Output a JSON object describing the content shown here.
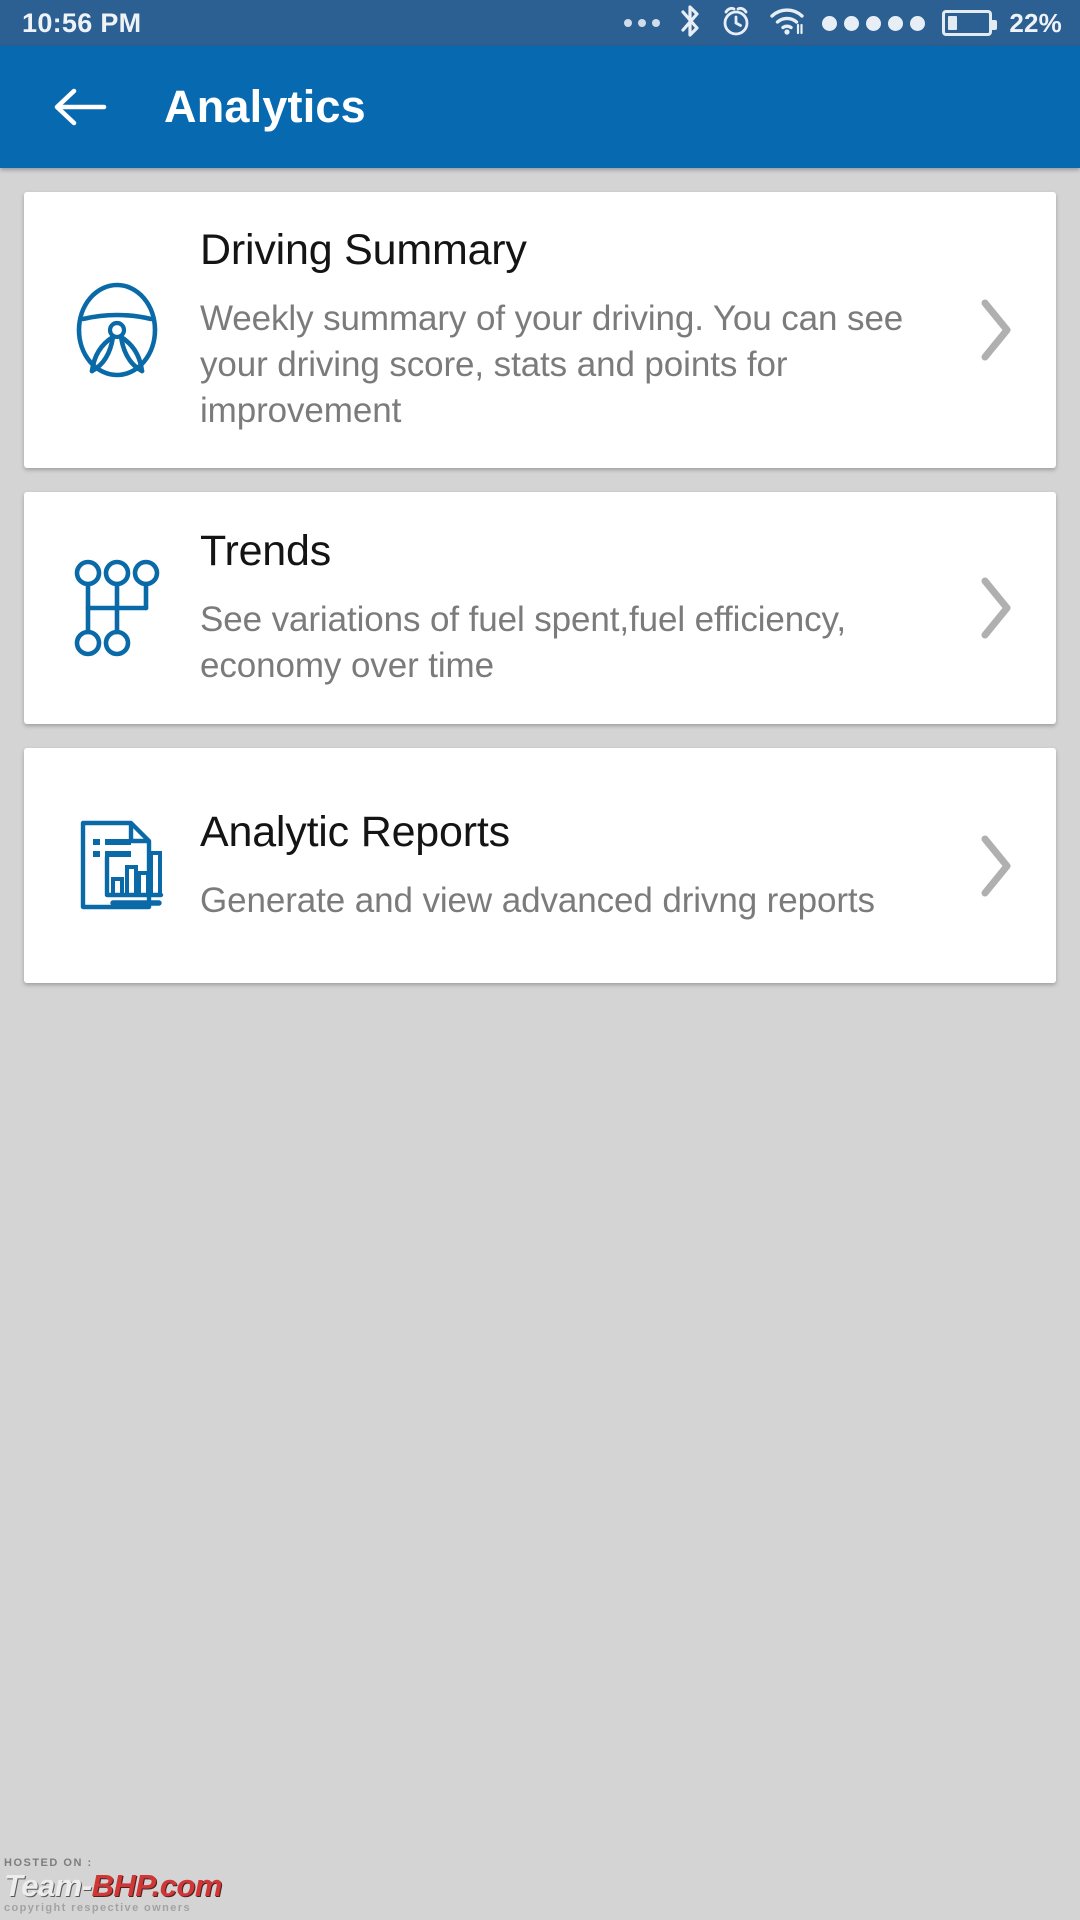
{
  "status_bar": {
    "time": "10:56 PM",
    "battery_percent": "22%",
    "battery_level": 22,
    "icons": [
      "more-dots-icon",
      "bluetooth-icon",
      "alarm-clock-icon",
      "wifi-icon"
    ],
    "signal_dot_count": 5,
    "background_color": "#2c5f92"
  },
  "app_bar": {
    "title": "Analytics",
    "back_icon": "arrow-left-icon",
    "background_color": "#0769b0",
    "text_color": "#ffffff"
  },
  "theme": {
    "page_background": "#d4d4d4",
    "card_background": "#ffffff",
    "accent": "#0a6aa8",
    "title_color": "#141414",
    "description_color": "#7b7b7b",
    "chevron_color": "#b0b0b0"
  },
  "cards": [
    {
      "id": "driving-summary",
      "icon": "steering-wheel-icon",
      "title": "Driving Summary",
      "description": "Weekly summary of your driving. You can see your driving score, stats and points for improvement",
      "chevron": "chevron-right-icon"
    },
    {
      "id": "trends",
      "icon": "gear-shifter-icon",
      "title": "Trends",
      "description": "See variations of fuel spent,fuel efficiency, economy over time",
      "chevron": "chevron-right-icon"
    },
    {
      "id": "analytic-reports",
      "icon": "report-document-chart-icon",
      "title": "Analytic Reports",
      "description": "Generate and view advanced drivng reports",
      "chevron": "chevron-right-icon"
    }
  ],
  "watermark": {
    "hosted_on": "HOSTED ON :",
    "site_part1": "Team-",
    "site_part2": "BHP.com",
    "copyright": "copyright respective owners"
  }
}
